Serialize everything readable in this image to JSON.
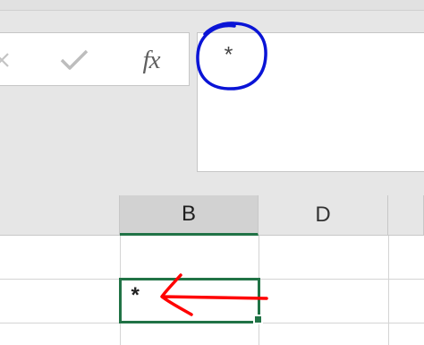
{
  "formula_toolbar": {
    "cancel_icon": "cancel-x-icon",
    "enter_icon": "checkmark-icon",
    "function_label": "fx"
  },
  "formula_bar": {
    "value": "*"
  },
  "columns": {
    "b_label": "B",
    "d_label": "D"
  },
  "active_cell": {
    "column": "B",
    "value": "*"
  },
  "annotations": {
    "circle_color": "#0a14d6",
    "arrow_color": "#ff0000"
  },
  "colors": {
    "selection_green": "#217346",
    "header_gray": "#e6e6e6",
    "selected_header_gray": "#d2d2d2"
  }
}
